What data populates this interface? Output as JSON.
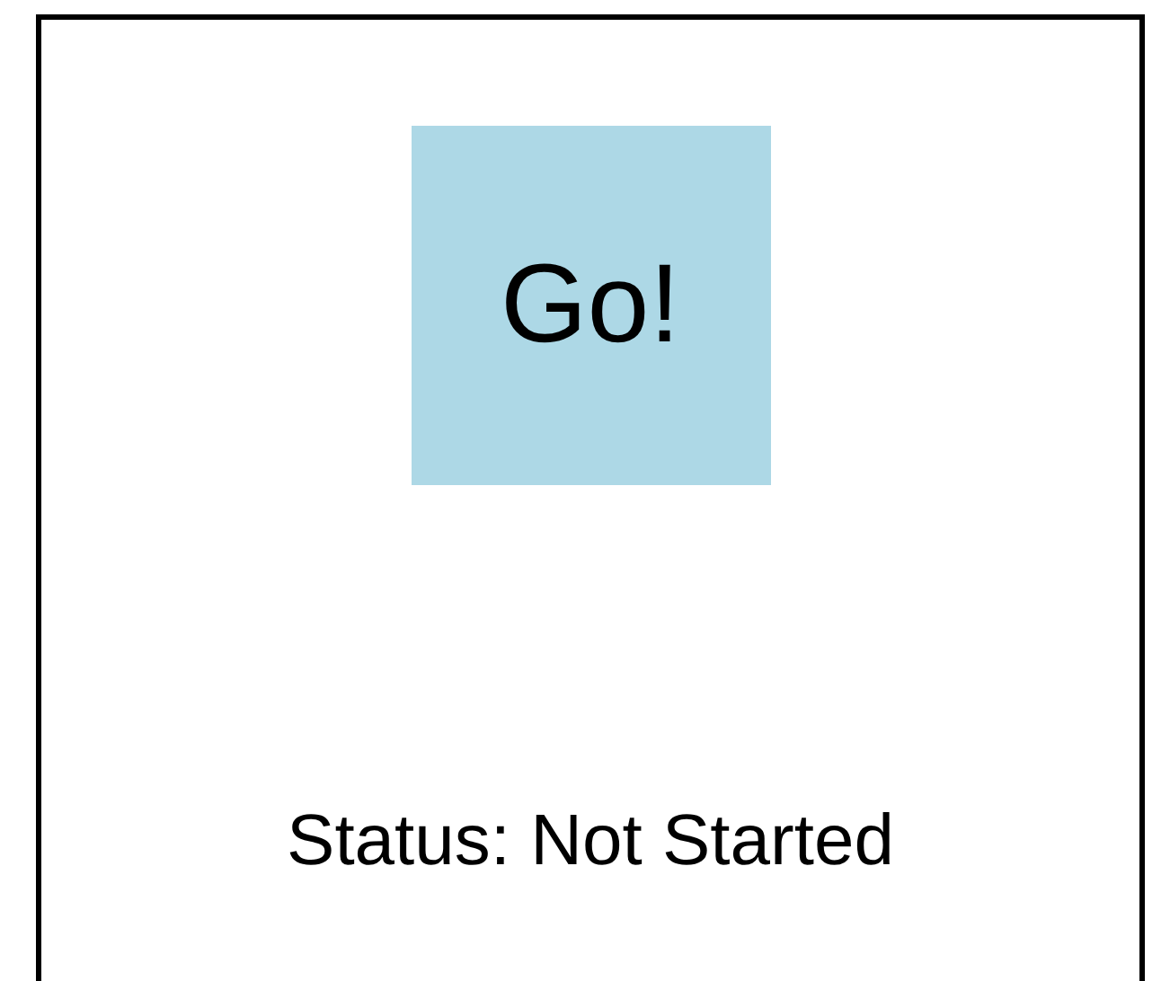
{
  "button": {
    "label": "Go!"
  },
  "status": {
    "text": "Status: Not Started"
  }
}
